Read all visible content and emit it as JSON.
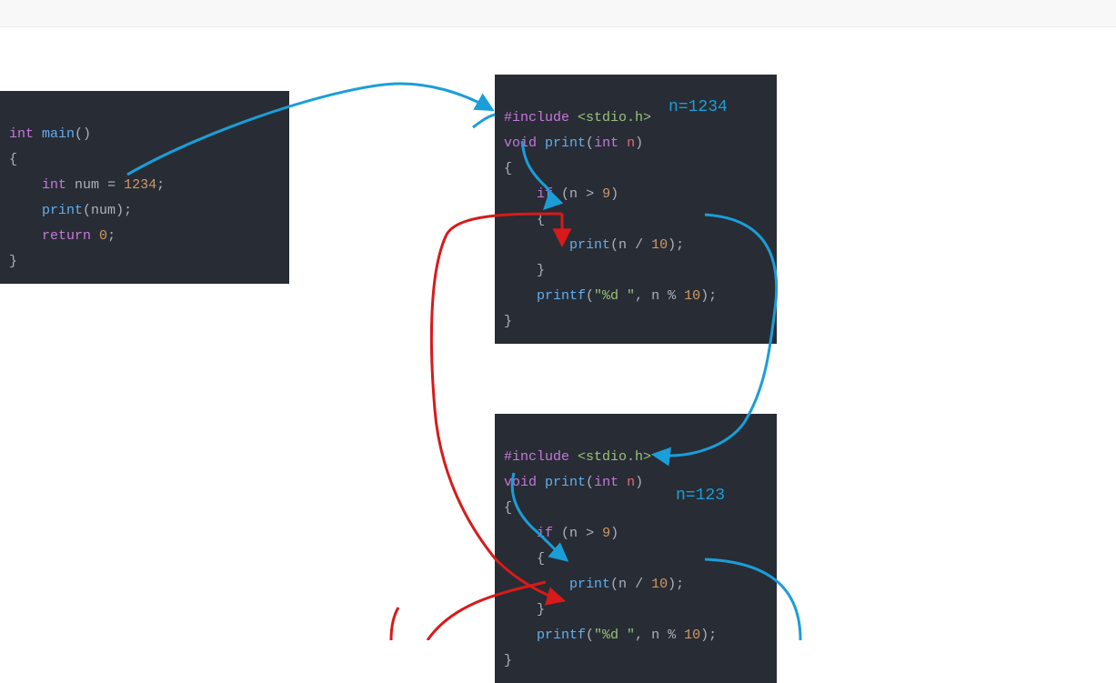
{
  "topbar": {},
  "annotations": {
    "call1": "n=1234",
    "call2": "n=123"
  },
  "colors": {
    "bg_code": "#282c34",
    "blue_ann": "#1a9ed8",
    "arrow_blue": "#1a9ed8",
    "arrow_red": "#d81a1a"
  },
  "block_main": {
    "l1_int": "int",
    "l1_main": "main",
    "l1_paren": "()",
    "l2_brace": "{",
    "l3_indent": "    ",
    "l3_int": "int",
    "l3_sp": " ",
    "l3_num": "num",
    "l3_eq": " = ",
    "l3_val": "1234",
    "l3_semi": ";",
    "l4_indent": "    ",
    "l4_print": "print",
    "l4_open": "(",
    "l4_arg": "num",
    "l4_close": ");",
    "l5_indent": "    ",
    "l5_return": "return",
    "l5_sp": " ",
    "l5_zero": "0",
    "l5_semi": ";",
    "l6_brace": "}"
  },
  "block_print": {
    "l1_pp": "#include",
    "l1_sp": " ",
    "l1_inc": "<stdio.h>",
    "l2_void": "void",
    "l2_sp": " ",
    "l2_print": "print",
    "l2_open": "(",
    "l2_int": "int",
    "l2_sp2": " ",
    "l2_n": "n",
    "l2_close": ")",
    "l3_brace": "{",
    "l4_indent": "    ",
    "l4_if": "if",
    "l4_cond_open": " (",
    "l4_n": "n",
    "l4_gt": " > ",
    "l4_nine": "9",
    "l4_cond_close": ")",
    "l5_indent": "    ",
    "l5_brace": "{",
    "l6_indent": "        ",
    "l6_print": "print",
    "l6_open": "(",
    "l6_n": "n",
    "l6_div": " / ",
    "l6_ten": "10",
    "l6_close": ");",
    "l7_indent": "    ",
    "l7_brace": "}",
    "l8_indent": "    ",
    "l8_printf": "printf",
    "l8_open": "(",
    "l8_fmt": "\"%d \"",
    "l8_comma": ", ",
    "l8_n": "n",
    "l8_mod": " % ",
    "l8_ten": "10",
    "l8_close": ");",
    "l9_brace": "}"
  }
}
